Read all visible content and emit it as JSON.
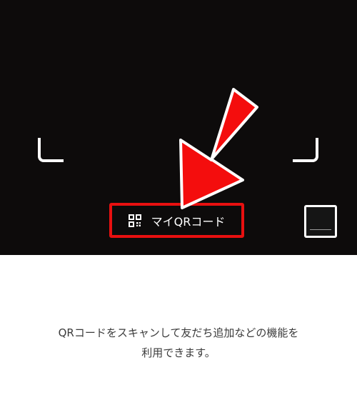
{
  "scanner": {
    "my_qr_label": "マイQRコード",
    "icons": {
      "my_qr": "qr-code-icon",
      "annotation": "red-arrow-icon",
      "gallery": "image-thumbnail"
    },
    "colors": {
      "camera_bg": "#0d0b0b",
      "highlight": "#e81010",
      "frame": "#ffffff"
    }
  },
  "info": {
    "line1": "QRコードをスキャンして友だち追加などの機能を",
    "line2": "利用できます。"
  }
}
